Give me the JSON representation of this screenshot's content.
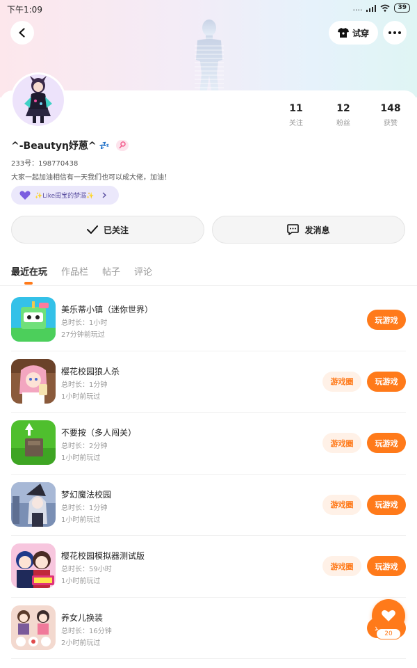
{
  "status_bar": {
    "time": "下午1:09",
    "signal": "....",
    "battery": "39"
  },
  "header": {
    "back_icon": "back-arrow-icon",
    "try_on_label": "试穿",
    "more_icon": "more-dots-icon"
  },
  "profile": {
    "username": "^-Beautyη妤蒽^",
    "sleep_emoji": "💤",
    "uid": "233号：198770438",
    "bio": "大家一起加油相信有一天我们也可以成大佬，加油！",
    "club_label": "✨Like闺宝的梦溺✨",
    "stats": [
      {
        "value": "11",
        "label": "关注"
      },
      {
        "value": "12",
        "label": "粉丝"
      },
      {
        "value": "148",
        "label": "获赞"
      }
    ]
  },
  "actions": {
    "following_label": "已关注",
    "message_label": "发消息"
  },
  "tabs": [
    {
      "label": "最近在玩"
    },
    {
      "label": "作品栏"
    },
    {
      "label": "帖子"
    },
    {
      "label": "评论"
    }
  ],
  "games": [
    {
      "name": "美乐蒂小镇（迷你世界）",
      "duration": "总时长：1小时",
      "last_played": "27分钟前玩过",
      "has_circle": false,
      "play_label": "玩游戏"
    },
    {
      "name": "樱花校园狼人杀",
      "duration": "总时长：1分钟",
      "last_played": "1小时前玩过",
      "has_circle": true,
      "circle_label": "游戏圈",
      "play_label": "玩游戏"
    },
    {
      "name": "不要按（多人闯关）",
      "duration": "总时长：2分钟",
      "last_played": "1小时前玩过",
      "has_circle": true,
      "circle_label": "游戏圈",
      "play_label": "玩游戏"
    },
    {
      "name": "梦幻魔法校园",
      "duration": "总时长：1分钟",
      "last_played": "1小时前玩过",
      "has_circle": true,
      "circle_label": "游戏圈",
      "play_label": "玩游戏"
    },
    {
      "name": "樱花校园模拟器测试版",
      "duration": "总时长：59小时",
      "last_played": "1小时前玩过",
      "has_circle": true,
      "circle_label": "游戏圈",
      "play_label": "玩游戏"
    },
    {
      "name": "养女儿换装",
      "duration": "总时长：16分钟",
      "last_played": "2小时前玩过",
      "has_circle": false,
      "play_label": "玩游戏"
    }
  ],
  "fab": {
    "icon": "heart-icon",
    "count": "20"
  },
  "colors": {
    "accent": "#ff7a1a",
    "circle_bg": "#fff1e7",
    "club_bg": "#ebe8fb"
  }
}
